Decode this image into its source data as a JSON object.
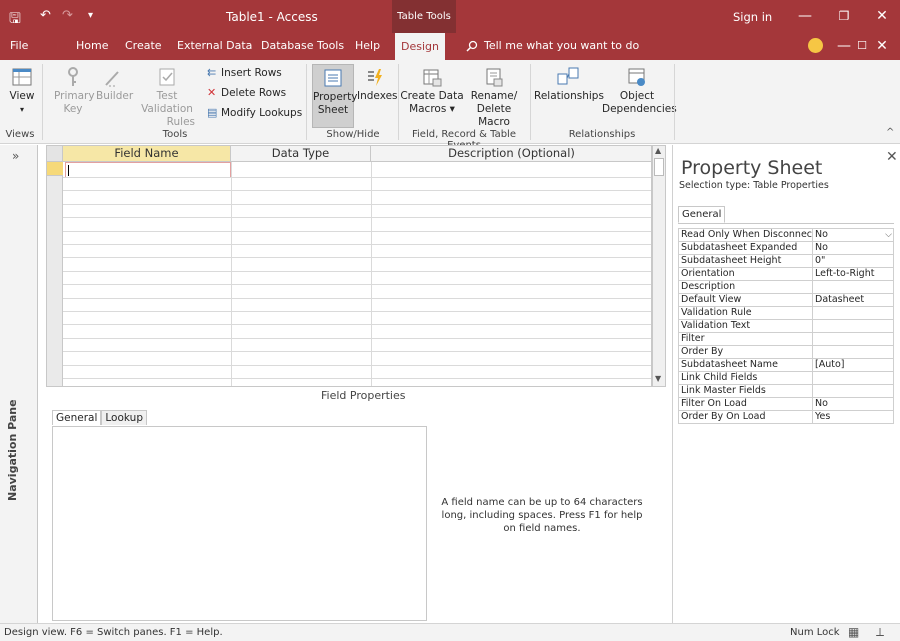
{
  "window": {
    "title": "Table1 - Access",
    "context_tab_group": "Table Tools",
    "sign_in": "Sign in"
  },
  "ribbon_tabs": [
    "File",
    "Home",
    "Create",
    "External Data",
    "Database Tools",
    "Help",
    "Design"
  ],
  "active_tab": "Design",
  "tell_me": "Tell me what you want to do",
  "ribbon": {
    "views": {
      "view_label": "View",
      "group": "Views"
    },
    "tools": {
      "primary_key": [
        "Primary",
        "Key"
      ],
      "builder": "Builder",
      "test_validation": [
        "Test Validation",
        "Rules"
      ],
      "insert_rows": "Insert Rows",
      "delete_rows": "Delete Rows",
      "modify_lookups": "Modify Lookups",
      "group": "Tools"
    },
    "showhide": {
      "property_sheet": [
        "Property",
        "Sheet"
      ],
      "indexes": "Indexes",
      "group": "Show/Hide"
    },
    "events": {
      "create_data_macros": [
        "Create Data",
        "Macros ▾"
      ],
      "rename_delete_macro": [
        "Rename/",
        "Delete Macro"
      ],
      "group": "Field, Record & Table Events"
    },
    "relationships": {
      "relationships": "Relationships",
      "object_dependencies": [
        "Object",
        "Dependencies"
      ],
      "group": "Relationships"
    }
  },
  "nav_pane": {
    "label": "Navigation Pane",
    "toggle": "»"
  },
  "grid": {
    "columns": [
      "Field Name",
      "Data Type",
      "Description (Optional)"
    ]
  },
  "field_properties": {
    "label": "Field Properties",
    "tabs": [
      "General",
      "Lookup"
    ],
    "help": "A field name can be up to 64 characters long, including spaces. Press F1 for help on field names."
  },
  "property_sheet": {
    "title": "Property Sheet",
    "selection_type": "Selection type:  Table Properties",
    "tab": "General",
    "rows": [
      {
        "key": "Read Only When Disconnect",
        "value": "No"
      },
      {
        "key": "Subdatasheet Expanded",
        "value": "No"
      },
      {
        "key": "Subdatasheet Height",
        "value": "0\""
      },
      {
        "key": "Orientation",
        "value": "Left-to-Right"
      },
      {
        "key": "Description",
        "value": ""
      },
      {
        "key": "Default View",
        "value": "Datasheet"
      },
      {
        "key": "Validation Rule",
        "value": ""
      },
      {
        "key": "Validation Text",
        "value": ""
      },
      {
        "key": "Filter",
        "value": ""
      },
      {
        "key": "Order By",
        "value": ""
      },
      {
        "key": "Subdatasheet Name",
        "value": "[Auto]"
      },
      {
        "key": "Link Child Fields",
        "value": ""
      },
      {
        "key": "Link Master Fields",
        "value": ""
      },
      {
        "key": "Filter On Load",
        "value": "No"
      },
      {
        "key": "Order By On Load",
        "value": "Yes"
      }
    ]
  },
  "status_bar": {
    "text": "Design view.  F6 = Switch panes.  F1 = Help.",
    "num_lock": "Num Lock"
  },
  "colors": {
    "accent": "#a4373a",
    "context": "#833032",
    "ribbon_bg": "#f3f3f3"
  }
}
